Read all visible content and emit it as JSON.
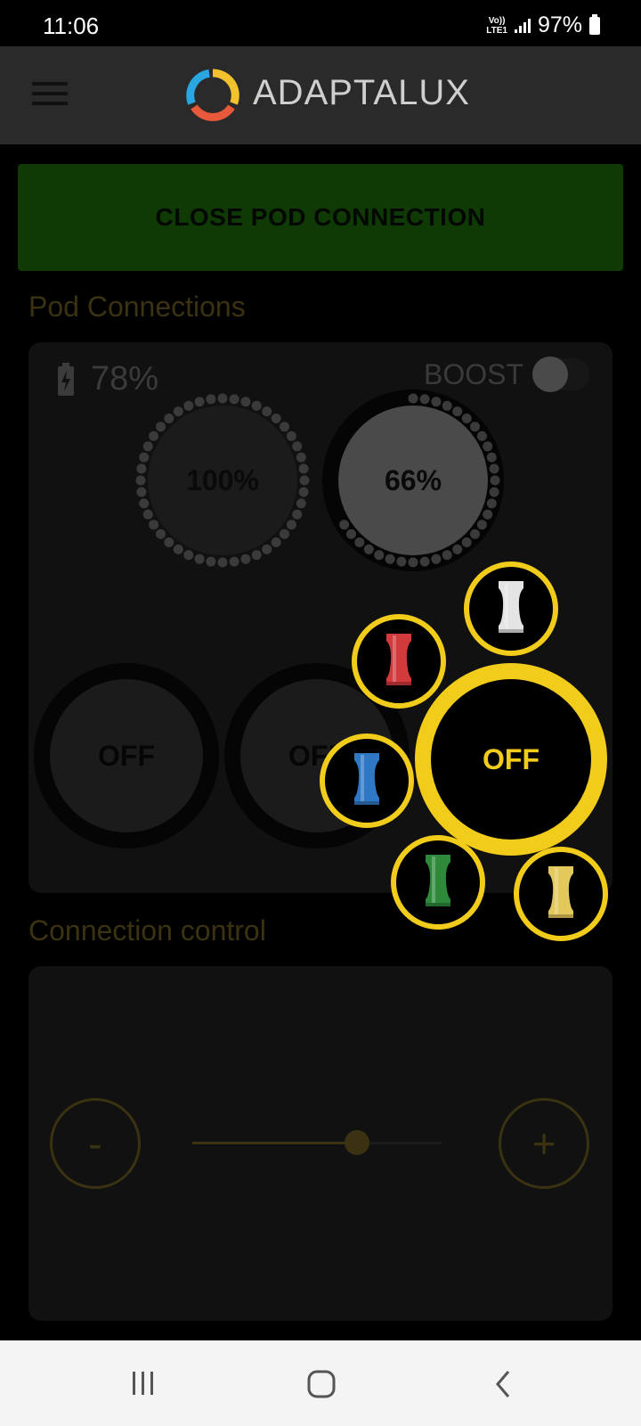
{
  "status_bar": {
    "time": "11:06",
    "network_top": "Vo))",
    "network_bottom": "LTE1",
    "battery": "97%"
  },
  "app_bar": {
    "brand": "ADAPTALUX",
    "menu_icon": "hamburger-menu-icon",
    "logo_icon": "adaptalux-ring-logo"
  },
  "close_button": {
    "label": "CLOSE POD CONNECTION",
    "color": "#0f3a06"
  },
  "pod_connections": {
    "title": "Pod Connections",
    "battery_icon": "battery-charging-icon",
    "battery_level": "78%",
    "boost_label": "BOOST",
    "boost_on": false,
    "dials": [
      {
        "label": "100%",
        "level": 1.0
      },
      {
        "label": "66%",
        "level": 0.66
      }
    ],
    "pods": [
      {
        "label": "OFF"
      },
      {
        "label": "OFF"
      },
      {
        "label": "OFF",
        "selected": true
      }
    ]
  },
  "color_picker": {
    "accent": "#f2cc1b",
    "filters": [
      {
        "name": "white",
        "hex": "#e4e4e4"
      },
      {
        "name": "red",
        "hex": "#d23a3c"
      },
      {
        "name": "blue",
        "hex": "#2f78c6"
      },
      {
        "name": "green",
        "hex": "#2e8a3a"
      },
      {
        "name": "yellow",
        "hex": "#e3c95c"
      }
    ]
  },
  "connection_control": {
    "title": "Connection control",
    "minus_label": "-",
    "plus_label": "+",
    "slider_value": 0.66
  },
  "nav_bar": {
    "recents_icon": "recents-icon",
    "home_icon": "home-icon",
    "back_icon": "back-icon"
  }
}
